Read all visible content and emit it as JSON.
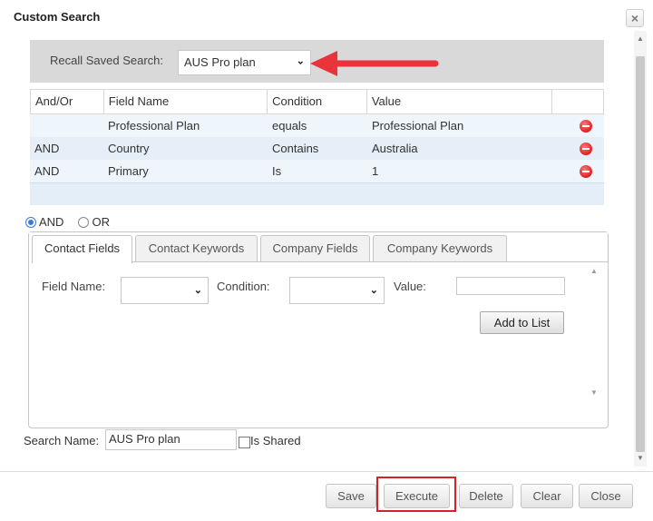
{
  "dialog": {
    "title": "Custom Search",
    "close_glyph": "×"
  },
  "recall": {
    "label": "Recall Saved Search:",
    "selected": "AUS Pro plan"
  },
  "grid": {
    "columns": [
      "And/Or",
      "Field Name",
      "Condition",
      "Value"
    ],
    "rows": [
      {
        "andor": "",
        "field": "Professional Plan",
        "condition": "equals",
        "value": "Professional Plan"
      },
      {
        "andor": "AND",
        "field": "Country",
        "condition": "Contains",
        "value": "Australia"
      },
      {
        "andor": "AND",
        "field": "Primary",
        "condition": "Is",
        "value": "1"
      }
    ]
  },
  "logic": {
    "options": [
      "AND",
      "OR"
    ],
    "selected": "AND"
  },
  "tabs": [
    {
      "label": "Contact Fields",
      "active": true
    },
    {
      "label": "Contact Keywords",
      "active": false
    },
    {
      "label": "Company Fields",
      "active": false
    },
    {
      "label": "Company Keywords",
      "active": false
    }
  ],
  "criteria": {
    "field_label": "Field Name:",
    "condition_label": "Condition:",
    "value_label": "Value:",
    "add_label": "Add to List"
  },
  "search_name": {
    "label": "Search Name:",
    "value": "AUS Pro plan",
    "shared_label": "Is Shared"
  },
  "buttons": {
    "save": "Save",
    "execute": "Execute",
    "delete": "Delete",
    "clear": "Clear",
    "close": "Close"
  },
  "colors": {
    "annotation": "#d7202a",
    "radio_selected": "#3a7bd5",
    "delete_icon": "#d22222"
  }
}
